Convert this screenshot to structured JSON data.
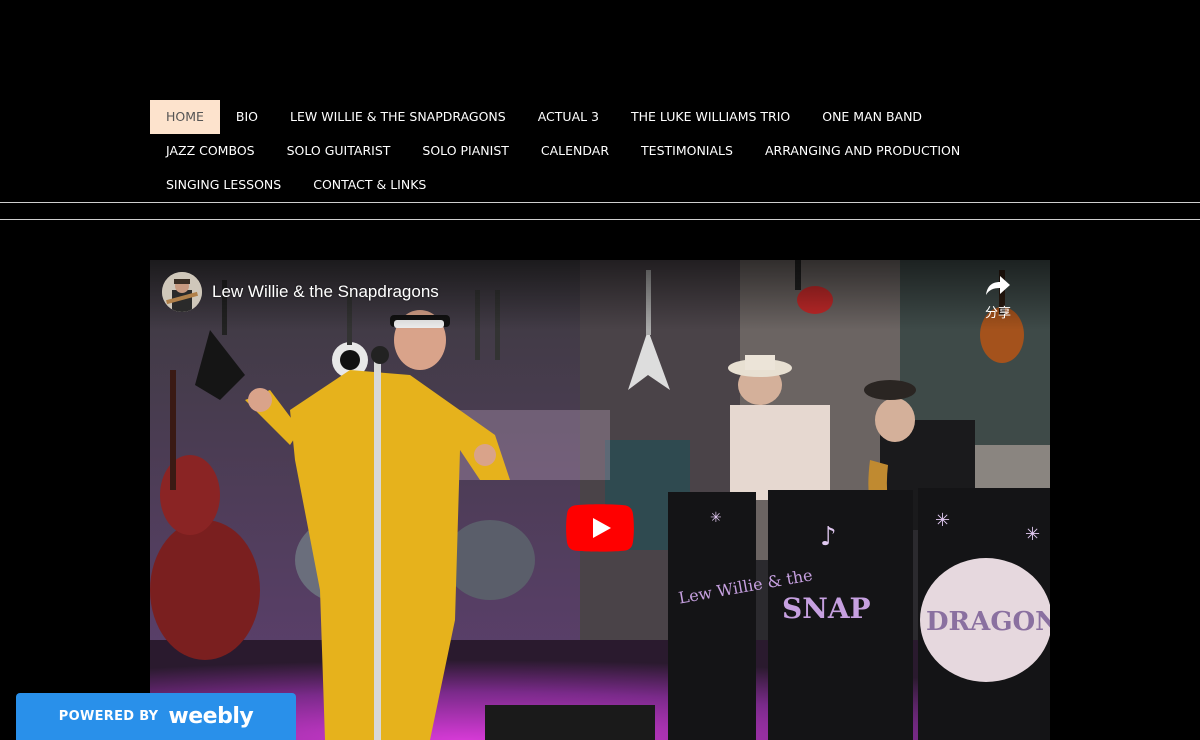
{
  "nav": {
    "items": [
      {
        "label": "HOME",
        "active": true
      },
      {
        "label": "BIO"
      },
      {
        "label": "LEW WILLIE & THE SNAPDRAGONS"
      },
      {
        "label": "ACTUAL 3"
      },
      {
        "label": "THE LUKE WILLIAMS TRIO"
      },
      {
        "label": "ONE MAN BAND"
      },
      {
        "label": "JAZZ COMBOS"
      },
      {
        "label": "SOLO GUITARIST"
      },
      {
        "label": "SOLO PIANIST"
      },
      {
        "label": "CALENDAR"
      },
      {
        "label": "TESTIMONIALS"
      },
      {
        "label": "ARRANGING AND PRODUCTION"
      },
      {
        "label": "SINGING LESSONS"
      },
      {
        "label": "CONTACT & LINKS"
      }
    ]
  },
  "video": {
    "title": "Lew Willie & the Snapdragons",
    "share_label": "分享",
    "stand_left_text": "Lew Willie & the",
    "stand_center_text": "SNAP",
    "stand_right_text": "DRAGONS"
  },
  "badge": {
    "powered_label": "POWERED BY",
    "logo_text": "weebly"
  },
  "colors": {
    "nav_active_bg": "#fde3cd",
    "badge_bg": "#2990ea",
    "play_red": "#ff0000"
  }
}
